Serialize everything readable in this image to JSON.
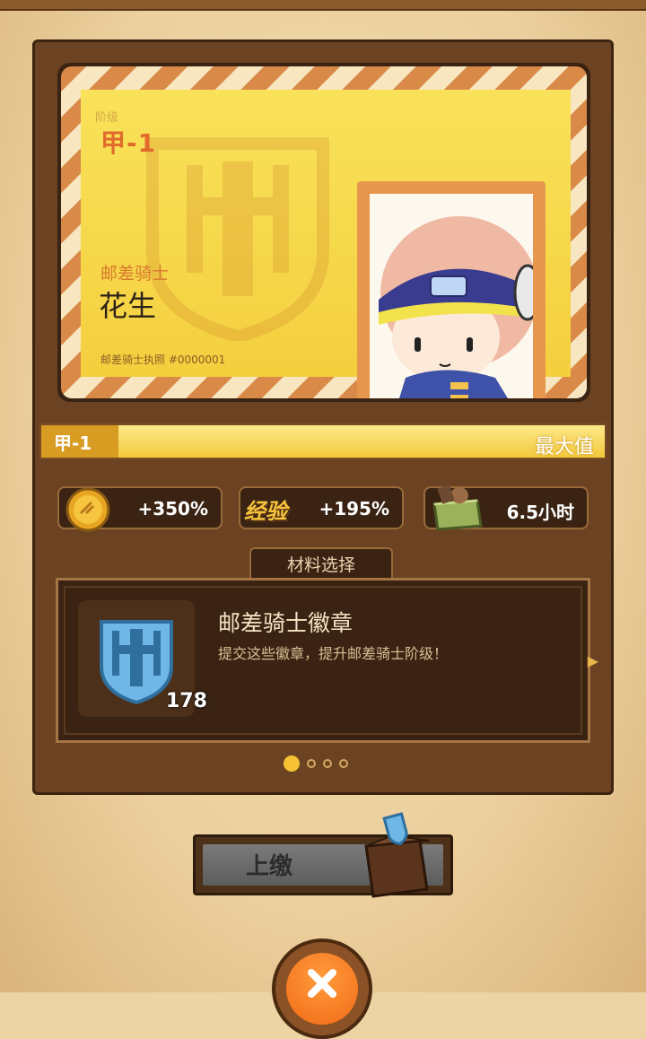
{
  "card": {
    "rank_label": "阶级",
    "rank_value": "甲-1",
    "title": "邮差骑士",
    "name": "花生",
    "license": "邮差骑士执照 #0000001"
  },
  "progress": {
    "level": "甲-1",
    "max_label": "最大值",
    "fill": 1.0
  },
  "stats": [
    {
      "icon": "gold-coin-icon",
      "value": "+350%"
    },
    {
      "icon": "exp-icon",
      "icon_text": "经验",
      "value": "+195%"
    },
    {
      "icon": "supply-crate-icon",
      "value": "6.5小时"
    }
  ],
  "materials": {
    "tab_label": "材料选择",
    "item_name": "邮差骑士徽章",
    "item_desc": "提交这些徽章，提升邮差骑士阶级！",
    "count": "178"
  },
  "pagination": {
    "pages": 4,
    "current": 1
  },
  "actions": {
    "submit_label": "上缴"
  },
  "colors": {
    "panel": "#6b4322",
    "card_gold": "#f4cf3e",
    "accent_orange": "#e16a2c",
    "badge_blue": "#6fb7e6"
  }
}
